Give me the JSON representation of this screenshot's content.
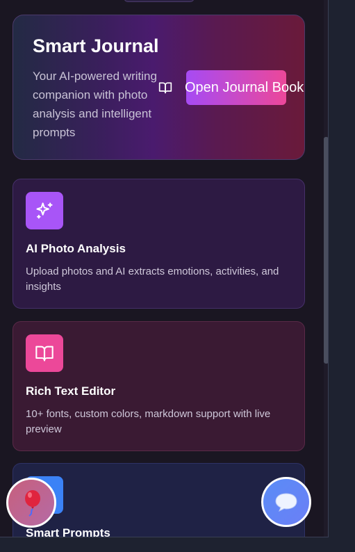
{
  "hero": {
    "title": "Smart Journal",
    "description": "Your AI-powered writing companion with photo analysis and intelligent prompts",
    "button_label": "Open Journal Book"
  },
  "features": [
    {
      "title": "AI Photo Analysis",
      "description": "Upload photos and AI extracts emotions, activities, and insights",
      "icon": "sparkles-icon",
      "color": "#a855f7"
    },
    {
      "title": "Rich Text Editor",
      "description": "10+ fonts, custom colors, markdown support with live preview",
      "icon": "book-open-icon",
      "color": "#ec4899"
    },
    {
      "title": "Smart Prompts",
      "description": "",
      "icon": "lightbulb-icon",
      "color": "#3b82f6"
    }
  ],
  "fabs": {
    "left_icon": "balloon-icon",
    "right_icon": "chat-bubble-icon"
  }
}
